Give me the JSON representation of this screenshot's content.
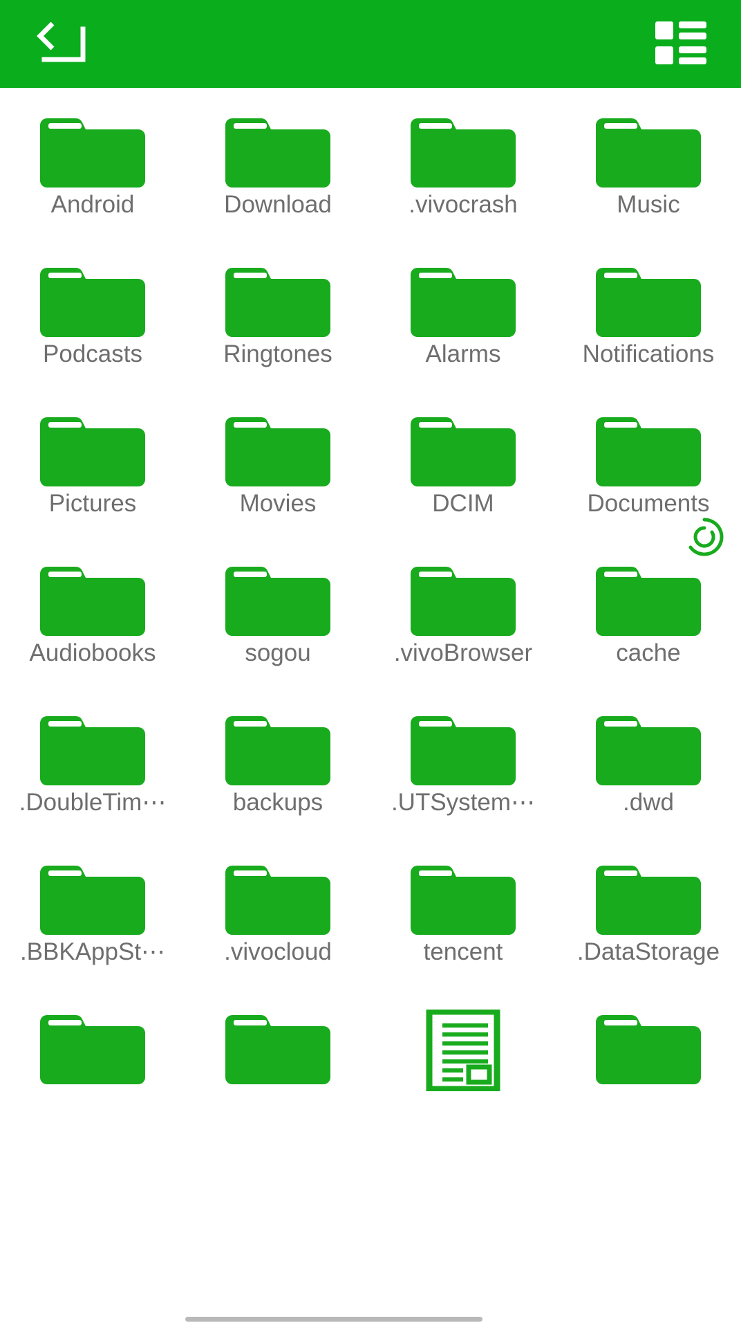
{
  "colors": {
    "brand_green": "#0aad1c",
    "folder_green": "#18ab1d",
    "label_gray": "#6e6e6e",
    "page_background": "#ffffff",
    "scrollbar_gray": "#b9b9b9"
  },
  "topbar": {
    "back_button": {
      "icon": "return-arrow-icon",
      "label": "Back"
    },
    "view_toggle_button": {
      "icon": "list-view-icon",
      "label": "Switch view"
    }
  },
  "grid": {
    "columns": 4,
    "items": [
      {
        "name": "Android",
        "type": "folder",
        "badge": null
      },
      {
        "name": "Download",
        "type": "folder",
        "badge": null
      },
      {
        "name": ".vivocrash",
        "type": "folder",
        "badge": null
      },
      {
        "name": "Music",
        "type": "folder",
        "badge": null
      },
      {
        "name": "Podcasts",
        "type": "folder",
        "badge": null
      },
      {
        "name": "Ringtones",
        "type": "folder",
        "badge": null
      },
      {
        "name": "Alarms",
        "type": "folder",
        "badge": null
      },
      {
        "name": "Notifications",
        "type": "folder",
        "badge": null
      },
      {
        "name": "Pictures",
        "type": "folder",
        "badge": null
      },
      {
        "name": "Movies",
        "type": "folder",
        "badge": null
      },
      {
        "name": "DCIM",
        "type": "folder",
        "badge": null
      },
      {
        "name": "Documents",
        "type": "folder",
        "badge": null
      },
      {
        "name": "Audiobooks",
        "type": "folder",
        "badge": null
      },
      {
        "name": "sogou",
        "type": "folder",
        "badge": null
      },
      {
        "name": ".vivoBrowser",
        "type": "folder",
        "badge": null
      },
      {
        "name": "cache",
        "type": "folder",
        "badge": "sync-icon"
      },
      {
        "name": ".DoubleTim⋯",
        "type": "folder",
        "badge": null
      },
      {
        "name": "backups",
        "type": "folder",
        "badge": null
      },
      {
        "name": ".UTSystem⋯",
        "type": "folder",
        "badge": null
      },
      {
        "name": ".dwd",
        "type": "folder",
        "badge": null
      },
      {
        "name": ".BBKAppSt⋯",
        "type": "folder",
        "badge": null
      },
      {
        "name": ".vivocloud",
        "type": "folder",
        "badge": null
      },
      {
        "name": "tencent",
        "type": "folder",
        "badge": null
      },
      {
        "name": ".DataStorage",
        "type": "folder",
        "badge": null
      },
      {
        "name": "",
        "type": "folder",
        "badge": null
      },
      {
        "name": "",
        "type": "folder",
        "badge": null
      },
      {
        "name": "",
        "type": "document",
        "badge": null
      },
      {
        "name": "",
        "type": "folder",
        "badge": null
      }
    ]
  },
  "scrollbar": {
    "visible": true,
    "position": "bottom"
  }
}
